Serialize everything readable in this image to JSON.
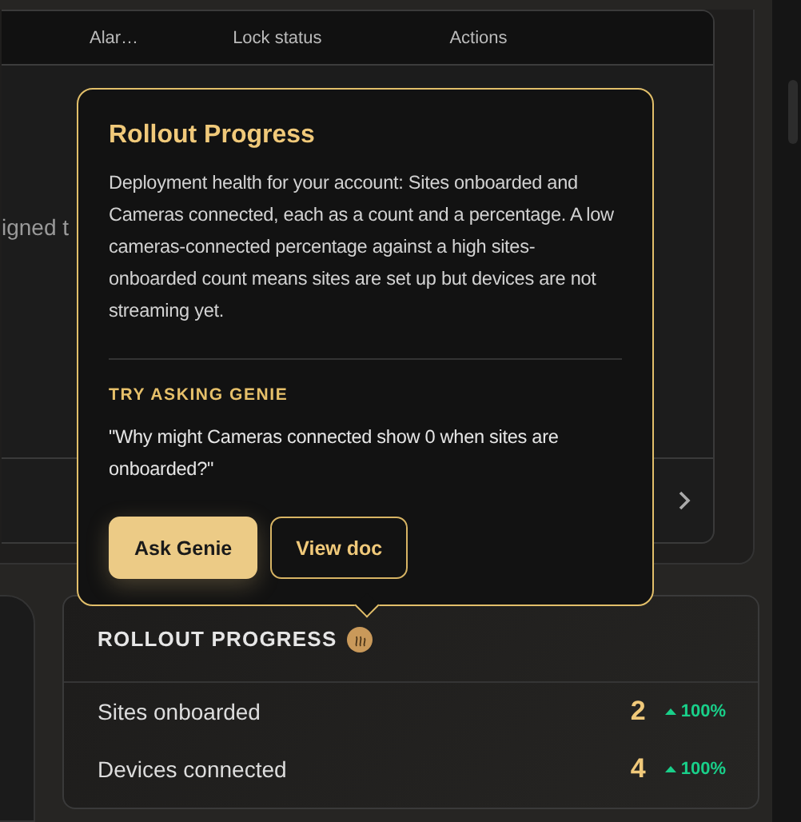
{
  "table": {
    "columns": [
      "Alar…",
      "Lock status",
      "Actions"
    ],
    "cell_text": "igned t"
  },
  "popover": {
    "title": "Rollout Progress",
    "body": "Deployment health for your account: Sites onboarded and Cameras connected, each as a count and a percentage. A low cameras-connected percentage against a high sites-onboarded count means sites are set up but devices are not streaming yet.",
    "suggestion_label": "TRY ASKING GENIE",
    "suggestion": "\"Why might Cameras connected show 0 when sites are onboarded?\"",
    "buttons": [
      {
        "label": "Ask Genie",
        "kind": "primary"
      },
      {
        "label": "View doc",
        "kind": "outline"
      }
    ]
  },
  "rollout_card": {
    "title": "ROLLOUT PROGRESS",
    "rows": [
      {
        "label": "Sites onboarded",
        "value": "2",
        "change": "100%"
      },
      {
        "label": "Devices connected",
        "value": "4",
        "change": "100%"
      }
    ]
  }
}
